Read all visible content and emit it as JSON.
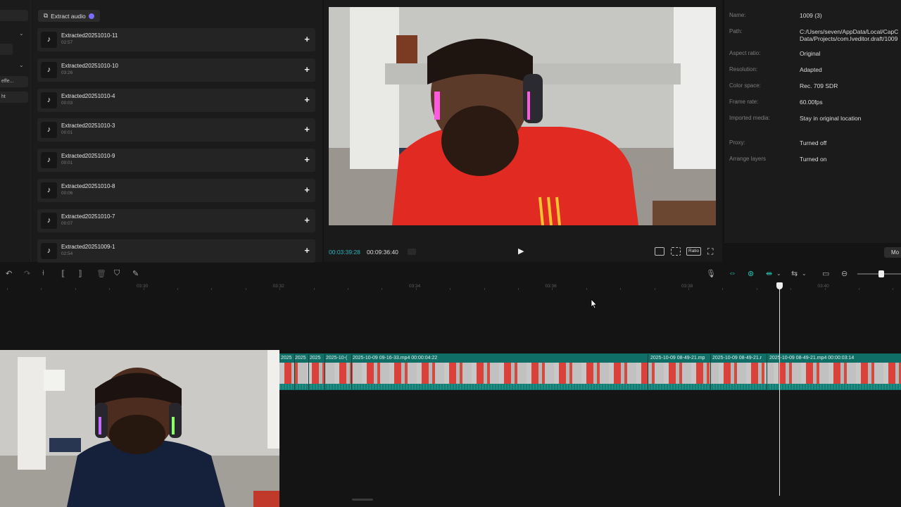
{
  "left_strip": {
    "items": [
      "",
      "",
      "",
      "effe...",
      "ht"
    ]
  },
  "media": {
    "extract_label": "Extract audio",
    "items": [
      {
        "name": "Extracted20251010-11",
        "duration": "02:57"
      },
      {
        "name": "Extracted20251010-10",
        "duration": "03:26"
      },
      {
        "name": "Extracted20251010-4",
        "duration": "00:03"
      },
      {
        "name": "Extracted20251010-3",
        "duration": "00:01"
      },
      {
        "name": "Extracted20251010-9",
        "duration": "00:01"
      },
      {
        "name": "Extracted20251010-8",
        "duration": "00:06"
      },
      {
        "name": "Extracted20251010-7",
        "duration": "00:07"
      },
      {
        "name": "Extracted20251009-1",
        "duration": "02:54"
      }
    ]
  },
  "player": {
    "current_time": "00:03:39:28",
    "total_time": "00:09:36:40",
    "ratio_label": "Ratio"
  },
  "details": {
    "rows": [
      {
        "label": "Name:",
        "value": "1009 (3)"
      },
      {
        "label": "Path:",
        "value": "C:/Users/seven/AppData/Local/CapC",
        "value2": "Data/Projects/com.lveditor.draft/1009"
      },
      {
        "label": "Aspect ratio:",
        "value": "Original"
      },
      {
        "label": "Resolution:",
        "value": "Adapted"
      },
      {
        "label": "Color space:",
        "value": "Rec. 709 SDR"
      },
      {
        "label": "Frame rate:",
        "value": "60.00fps"
      },
      {
        "label": "Imported media:",
        "value": "Stay in original location"
      },
      {
        "label": "Proxy:",
        "value": "Turned off"
      },
      {
        "label": "Arrange layers",
        "value": "Turned on"
      }
    ],
    "modify_label": "Mo"
  },
  "timeline": {
    "ruler": [
      "03:30",
      "03:32",
      "03:34",
      "03:36",
      "03:38",
      "03:40"
    ],
    "clips": [
      "2025",
      "2025",
      "2025",
      "2025-10-(",
      "2025-10-09 09-16-33.mp4   00:00:04:22",
      "2025-10-09 08-49-21.mp",
      "2025-10-09 08-49-21.r",
      "2025-10-09 08-49-21.mp4   00:00:03:14"
    ]
  },
  "colors": {
    "accent": "#1fc7b6",
    "track": "#0f6e66",
    "timecode": "#2bb5c0"
  }
}
